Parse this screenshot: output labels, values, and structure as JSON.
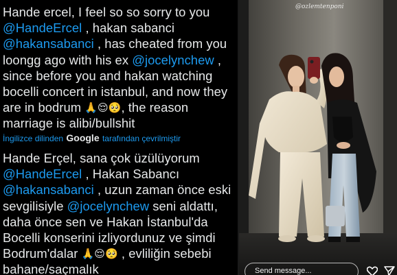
{
  "tweet": {
    "original": {
      "t1": "Hande ercel, I feel so so sorry to you ",
      "m1": "@HandeErcel",
      "t2": " , hakan sabanci ",
      "m2": "@hakansabanci",
      "t3": " , has cheated from you loongg ago with his ex ",
      "m3": "@jocelynchew",
      "t4": " , since before you and hakan watching bocelli concert in istanbul, and now they are in bodrum ",
      "e1": "🙏😌🥺",
      "t5": ", the reason marriage is alibi/bullshit"
    },
    "translation_note": {
      "prefix": "İngilizce dilinden ",
      "brand": "Google",
      "suffix": " tarafından çevrilmiştir"
    },
    "translated": {
      "t1": "Hande Erçel, sana çok üzülüyorum ",
      "m1": "@HandeErcel",
      "t2": " , Hakan Sabancı ",
      "m2": "@hakansabanci",
      "t3": " , uzun zaman önce eski sevgilisiyle ",
      "m3": "@jocelynchew",
      "t4": " seni aldattı, daha önce sen ve Hakan İstanbul'da Bocelli konserini izliyordunuz ve şimdi Bodrum'dalar ",
      "e1": "🙏😌🥺",
      "t5": " , evliliğin sebebi bahane/saçmalık"
    }
  },
  "story": {
    "watermark": "@ozlemtenponi",
    "message_placeholder": "Send message...",
    "icons": [
      "heart-icon",
      "send-icon"
    ]
  },
  "colors": {
    "mention": "#1d9bf0",
    "text": "#e7e9ea",
    "background": "#000000"
  }
}
